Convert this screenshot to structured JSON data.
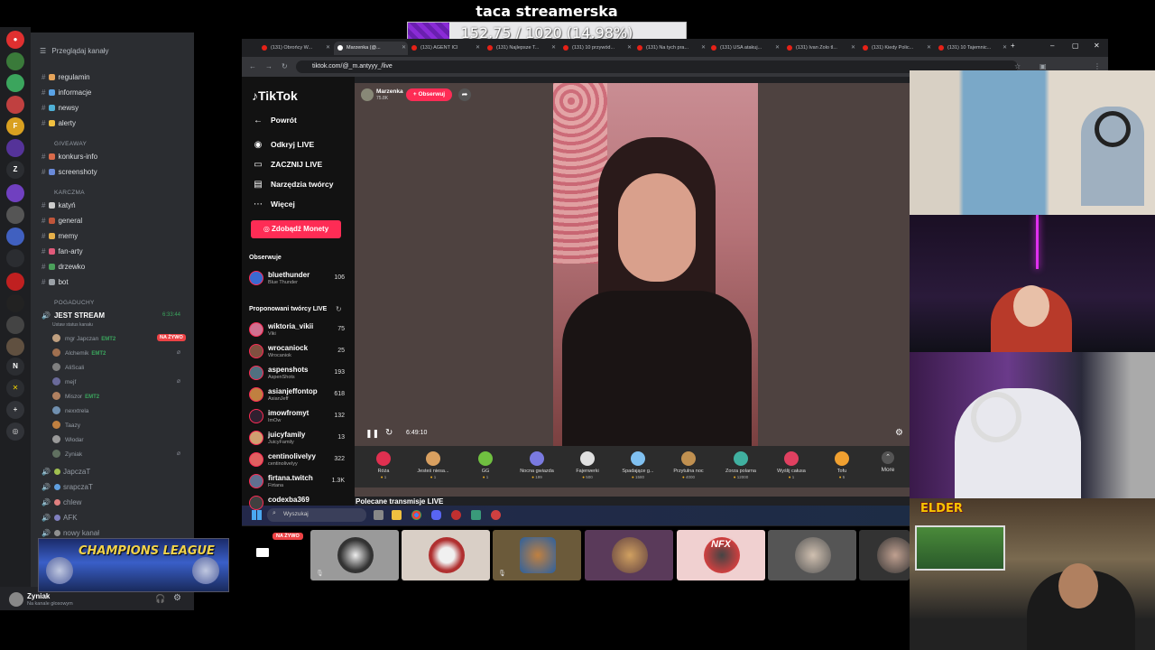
{
  "overlay": {
    "title": "taca streamerska",
    "goal_text": "152.75 / 1020 (14.98%)",
    "goal_fraction": 0.1498,
    "goal_fill_color": "#8a2bd6"
  },
  "discord": {
    "browse_label": "Przeglądaj kanały",
    "channels": [
      {
        "label": "regulamin",
        "icon": "scroll-icon",
        "color": "#e6a45a"
      },
      {
        "label": "informacje",
        "icon": "search-icon",
        "color": "#5aa3e6"
      },
      {
        "label": "newsy",
        "icon": "globe-icon",
        "color": "#4fb0d6"
      },
      {
        "label": "alerty",
        "icon": "bell-icon",
        "color": "#f0c040"
      }
    ],
    "cat_giveaway": "GIVEAWAY",
    "giveaway_channels": [
      {
        "label": "konkurs-info",
        "icon": "gift-icon",
        "color": "#d96a4a"
      },
      {
        "label": "screenshoty",
        "icon": "camera-icon",
        "color": "#6a8ad9"
      }
    ],
    "cat_karczma": "KARCZMA",
    "karczma_channels": [
      {
        "label": "katyń",
        "icon": "skull-icon",
        "color": "#cccccc"
      },
      {
        "label": "general",
        "icon": "ball-icon",
        "color": "#c0553a"
      },
      {
        "label": "memy",
        "icon": "face-icon",
        "color": "#e6b04a"
      },
      {
        "label": "fan-arty",
        "icon": "palette-icon",
        "color": "#e05a7a"
      },
      {
        "label": "drzewko",
        "icon": "tree-icon",
        "color": "#4aa05a"
      },
      {
        "label": "bot",
        "icon": "robot-icon",
        "color": "#9aa0a6"
      }
    ],
    "cat_pogaduchy": "POGADUCHY",
    "voice_channel": {
      "label": "JEST STREAM",
      "status": "Ustaw status kanału",
      "timer": "6:33:44"
    },
    "voice_users": [
      {
        "name": "mgr Japczan",
        "badge": "EMT2",
        "live": true
      },
      {
        "name": "Alchemik",
        "badge": "EMT2",
        "muted": true
      },
      {
        "name": "AliScali"
      },
      {
        "name": "mejf",
        "muted": true
      },
      {
        "name": "Miszor",
        "badge": "EMT2"
      },
      {
        "name": "nexxtrela"
      },
      {
        "name": "Taazy"
      },
      {
        "name": "Włodar"
      },
      {
        "name": "Zyniak",
        "muted": true
      }
    ],
    "live_tag": "NA ŻYWO",
    "more_voice": [
      {
        "label": "JapczaT",
        "color": "#a0c050"
      },
      {
        "label": "srapczaT",
        "color": "#60a0e0"
      },
      {
        "label": "chlew",
        "color": "#e08080"
      },
      {
        "label": "AFK",
        "color": "#8080c0"
      },
      {
        "label": "nowy kanał",
        "color": "#909090"
      }
    ],
    "cam_title": "CHAMPIONS LEAGUE",
    "user": {
      "name": "Zyniak",
      "status": "Na kanale głosowym"
    }
  },
  "browser": {
    "tabs": [
      "(131) Obrońcy W...",
      "Marzenka (@...",
      "(131) AGENT ICI",
      "(131) Najlepsze T...",
      "(131) 10 przywód...",
      "(131) Na tych pra...",
      "(131) USA atakuj...",
      "(131) Ivan Zolo tl...",
      "(131) Kiedy Polic...",
      "(131) 10 Tajemnic..."
    ],
    "url": "tiktok.com/@_m.antyyy_/live"
  },
  "tiktok": {
    "logo": "TikTok",
    "nav": [
      "Powrót",
      "Odkryj LIVE",
      "ZACZNIJ LIVE",
      "Narzędzia twórcy",
      "Więcej"
    ],
    "coins_button": "Zdobądź Monety",
    "following_title": "Obserwuje",
    "following": [
      {
        "name": "bluethunder",
        "sub": "Blue Thunder",
        "count": "106"
      }
    ],
    "suggested_title": "Proponowani twórcy LIVE",
    "suggested": [
      {
        "name": "wiktoria_vikii",
        "sub": "Viki",
        "count": "75"
      },
      {
        "name": "wrocaniock",
        "sub": "Wrocaniok",
        "count": "25"
      },
      {
        "name": "aspenshots",
        "sub": "AspenShots",
        "count": "193"
      },
      {
        "name": "asianjeffontop",
        "sub": "AsianJeff",
        "count": "618"
      },
      {
        "name": "imowfromyt",
        "sub": "ImOw",
        "count": "132"
      },
      {
        "name": "juicyfamily",
        "sub": "JuicyFamily",
        "count": "13"
      },
      {
        "name": "centinolivelyy",
        "sub": "centinolivelyy",
        "count": "322"
      },
      {
        "name": "firtana.twitch",
        "sub": "Firtana",
        "count": "1.3K"
      },
      {
        "name": "codexba369",
        "sub": "",
        "count": ""
      }
    ],
    "host": {
      "name": "Marzenka",
      "likes": "75.8K",
      "follow_label": "+ Obserwuj"
    },
    "video_time": "6:49:10",
    "gifts": [
      {
        "name": "Róża",
        "price": "1",
        "color": "#e03050"
      },
      {
        "name": "Jesteś niesa...",
        "price": "1",
        "color": "#d9a060"
      },
      {
        "name": "GG",
        "price": "1",
        "color": "#70c040"
      },
      {
        "name": "Nocna gwiazda",
        "price": "199",
        "color": "#7a7ae0"
      },
      {
        "name": "Fajerwerki",
        "price": "500",
        "color": "#e0e0e0"
      },
      {
        "name": "Spadające g...",
        "price": "1580",
        "color": "#80c0f0"
      },
      {
        "name": "Przytulna noc",
        "price": "4000",
        "color": "#c09050"
      },
      {
        "name": "Zorza polarna",
        "price": "12000",
        "color": "#40b0a0"
      },
      {
        "name": "Wyślij całusa",
        "price": "1",
        "color": "#e04060"
      },
      {
        "name": "Tofu",
        "price": "5",
        "color": "#f0a030"
      }
    ],
    "more_label": "More",
    "recommended": "Polecane transmisje LIVE"
  },
  "taskbar": {
    "search_placeholder": "Wyszukaj"
  },
  "tiles": {
    "live_tag": "NA ŻYWO",
    "nfx_label": "NFX"
  },
  "cams": {
    "elder_label": "ELDER"
  }
}
